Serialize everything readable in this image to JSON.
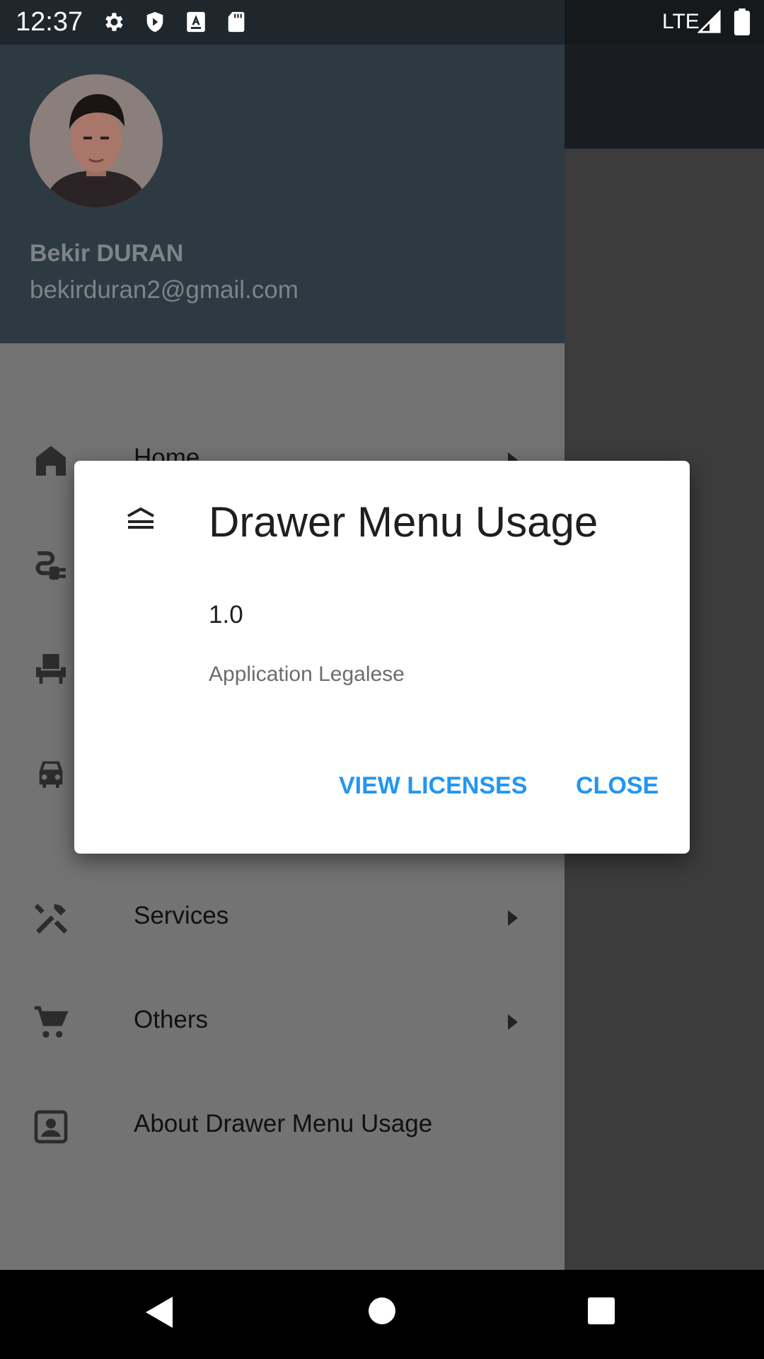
{
  "status_bar": {
    "time": "12:37",
    "network": "LTE",
    "icons": [
      "gear-icon",
      "shield-icon",
      "keyboard-a-icon",
      "sd-card-icon",
      "signal-icon",
      "battery-icon"
    ]
  },
  "drawer": {
    "header": {
      "user_name": "Bekir DURAN",
      "user_email": "bekirduran2@gmail.com"
    },
    "items": [
      {
        "label": "Home",
        "icon": "home-icon",
        "has_arrow": true
      },
      {
        "label": "",
        "icon": "power-plug-icon",
        "has_arrow": true
      },
      {
        "label": "",
        "icon": "seat-icon",
        "has_arrow": true
      },
      {
        "label": "",
        "icon": "car-icon",
        "has_arrow": true
      },
      {
        "label": "Services",
        "icon": "tools-icon",
        "has_arrow": true
      },
      {
        "label": "Others",
        "icon": "cart-icon",
        "has_arrow": true
      },
      {
        "label": "About Drawer Menu Usage",
        "icon": "contact-card-icon",
        "has_arrow": false
      }
    ]
  },
  "dialog": {
    "title": "Drawer Menu Usage",
    "version": "1.0",
    "legalese": "Application Legalese",
    "view_licenses_label": "VIEW LICENSES",
    "close_label": "CLOSE"
  },
  "colors": {
    "accent": "#2196f3",
    "drawer_header": "#2d3a42",
    "scrim_drawer": "#737373"
  }
}
